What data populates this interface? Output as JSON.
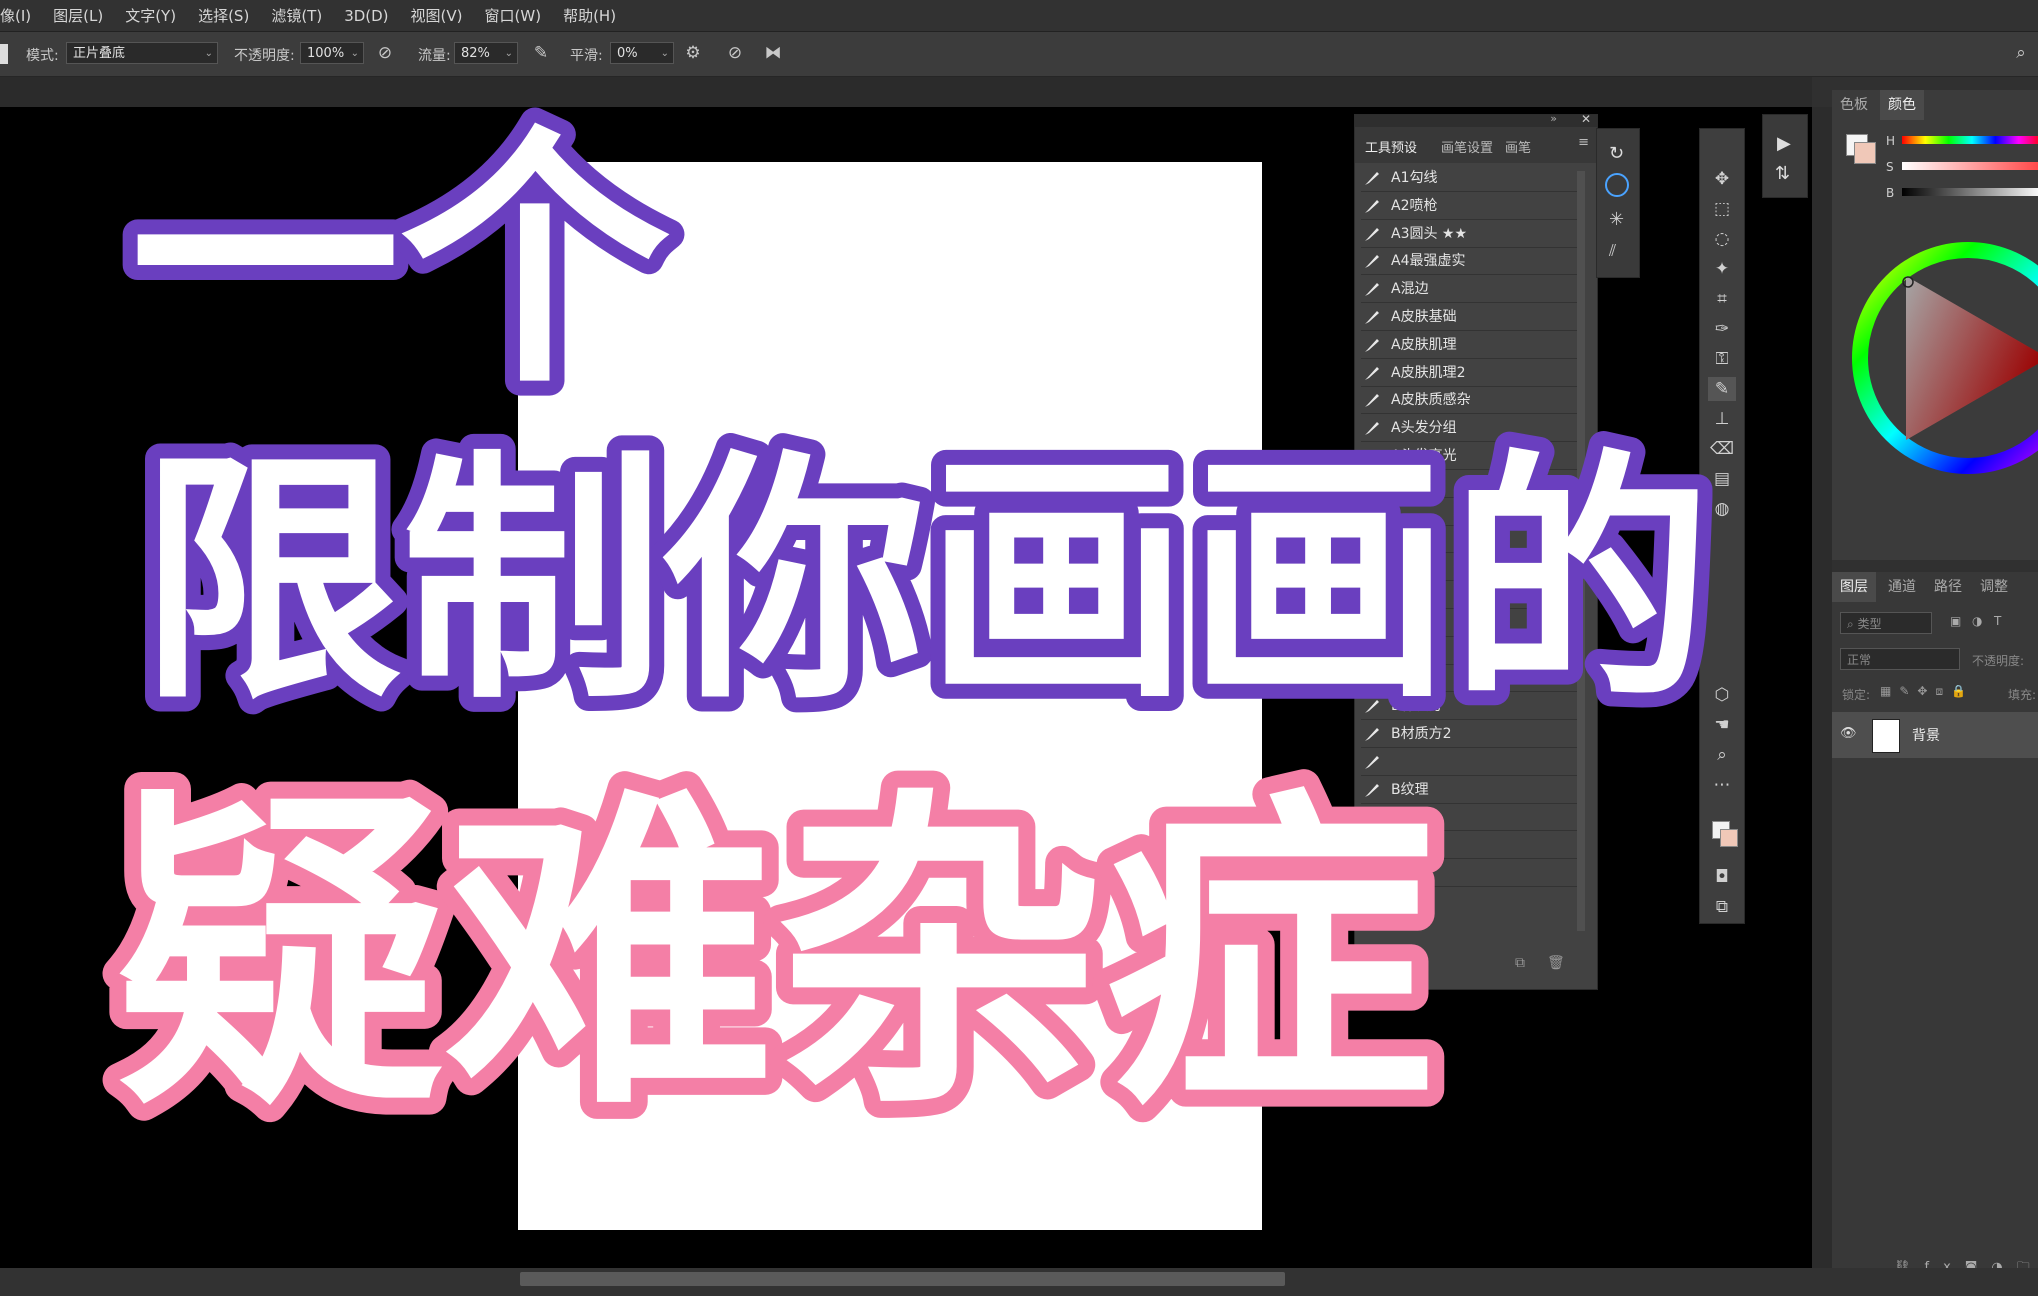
{
  "menubar": {
    "items": [
      "像(I)",
      "图层(L)",
      "文字(Y)",
      "选择(S)",
      "滤镜(T)",
      "3D(D)",
      "视图(V)",
      "窗口(W)",
      "帮助(H)"
    ]
  },
  "options": {
    "mode_label": "模式:",
    "mode_value": "正片叠底",
    "opacity_label": "不透明度:",
    "opacity_value": "100%",
    "flow_label": "流量:",
    "flow_value": "82%",
    "smooth_label": "平滑:",
    "smooth_value": "0%"
  },
  "brush_panel": {
    "tabs": [
      "工具预设",
      "画笔设置",
      "画笔"
    ],
    "items": [
      "A1勾线",
      "A2喷枪",
      "A3圆头 ★★",
      "A4最强虚实",
      "A混边",
      "A皮肤基础",
      "A皮肤肌理",
      "A皮肤肌理2",
      "A皮肤质感杂",
      "A头发分组",
      "A头发高光",
      "",
      "",
      "",
      "",
      "",
      "",
      "",
      "B三角",
      "B材质方",
      "B材质方2",
      "",
      "B纹理",
      "",
      "",
      ""
    ]
  },
  "color_panel": {
    "tabs": [
      "色板",
      "颜色"
    ],
    "sliders": [
      "H",
      "S",
      "B"
    ]
  },
  "layers_panel": {
    "tabs": [
      "图层",
      "通道",
      "路径",
      "调整"
    ],
    "filter_placeholder": "类型",
    "blend_mode": "正常",
    "opacity_label": "不透明度:",
    "lock_label": "锁定:",
    "fill_label": "填充:",
    "layer_name": "背景"
  },
  "overlay": {
    "line1": "一个",
    "line2": "限制你画画的",
    "line3": "疑难杂症",
    "colors": {
      "purple": "#6a3fbf",
      "pink": "#f47fa6",
      "fill": "#ffffff"
    }
  },
  "colors": {
    "accent": "#6a3fbf",
    "pink": "#f47fa6",
    "ps_bg": "#282828"
  }
}
